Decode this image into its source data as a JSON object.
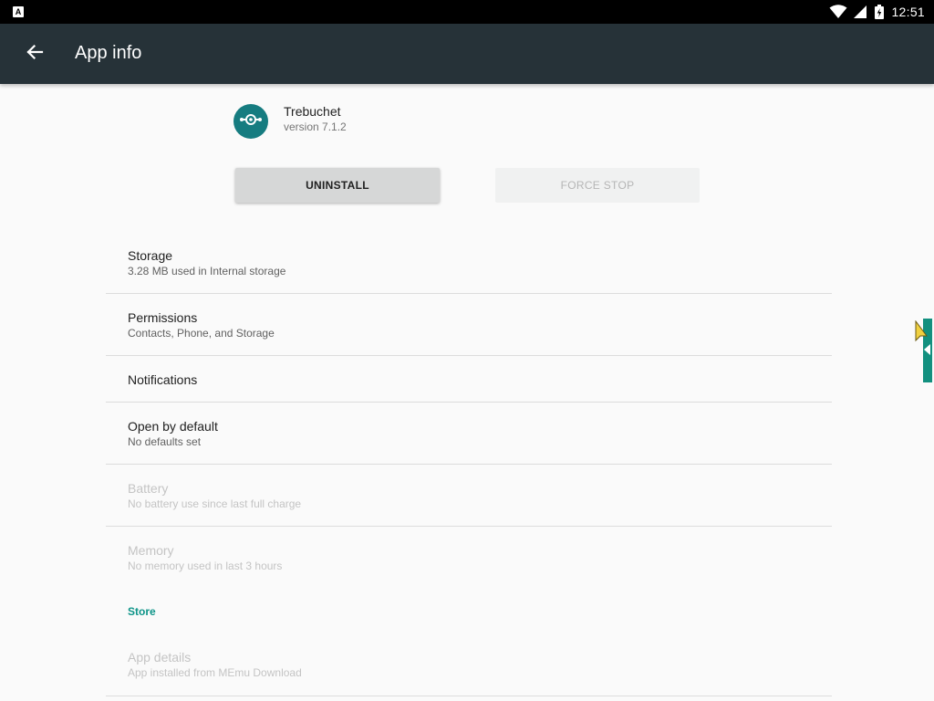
{
  "status_bar": {
    "notification_icon": "A",
    "time": "12:51",
    "icons": [
      "wifi-icon",
      "signal-icon",
      "battery-charging-icon"
    ]
  },
  "toolbar": {
    "back_icon": "arrow-back-icon",
    "title": "App info"
  },
  "app": {
    "name": "Trebuchet",
    "version": "version 7.1.2",
    "icon_color": "#167c80"
  },
  "buttons": {
    "uninstall": "UNINSTALL",
    "force_stop": "FORCE STOP"
  },
  "items": [
    {
      "title": "Storage",
      "summary": "3.28 MB used in Internal storage",
      "enabled": true
    },
    {
      "title": "Permissions",
      "summary": "Contacts, Phone, and Storage",
      "enabled": true
    },
    {
      "title": "Notifications",
      "summary": "",
      "enabled": true
    },
    {
      "title": "Open by default",
      "summary": "No defaults set",
      "enabled": true
    },
    {
      "title": "Battery",
      "summary": "No battery use since last full charge",
      "enabled": false
    },
    {
      "title": "Memory",
      "summary": "No memory used in last 3 hours",
      "enabled": false
    }
  ],
  "store_section": {
    "header": "Store",
    "app_details": {
      "title": "App details",
      "summary": "App installed from MEmu Download",
      "enabled": false
    }
  },
  "colors": {
    "toolbar": "#263238",
    "accent": "#0d9488",
    "edge_handle": "#12907f"
  }
}
